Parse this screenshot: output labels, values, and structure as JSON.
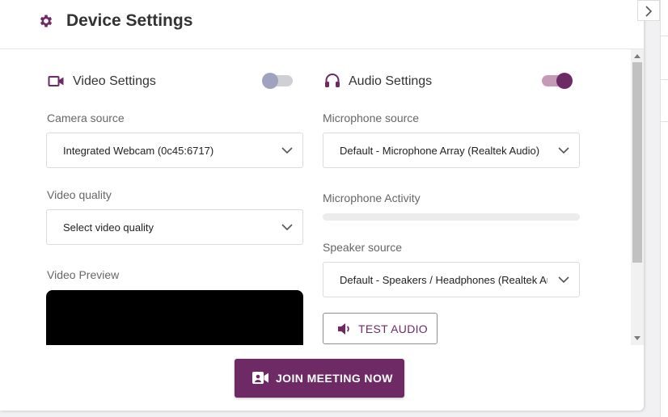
{
  "header": {
    "title": "Device Settings",
    "icon": "gear-icon"
  },
  "video": {
    "title": "Video Settings",
    "toggle_on": false,
    "camera_label": "Camera source",
    "camera_value": "Integrated Webcam (0c45:6717)",
    "quality_label": "Video quality",
    "quality_placeholder": "Select video quality",
    "preview_label": "Video Preview"
  },
  "audio": {
    "title": "Audio Settings",
    "toggle_on": true,
    "mic_label": "Microphone source",
    "mic_value": "Default - Microphone Array (Realtek Audio)",
    "activity_label": "Microphone Activity",
    "activity_level": 0,
    "speaker_label": "Speaker source",
    "speaker_value": "Default - Speakers / Headphones (Realtek Audio)",
    "test_button": "TEST AUDIO"
  },
  "footer": {
    "join_button": "JOIN MEETING NOW"
  },
  "colors": {
    "accent": "#6e2a65",
    "accent_light": "#c59ab8",
    "toggle_off": "#9fa3bf"
  }
}
